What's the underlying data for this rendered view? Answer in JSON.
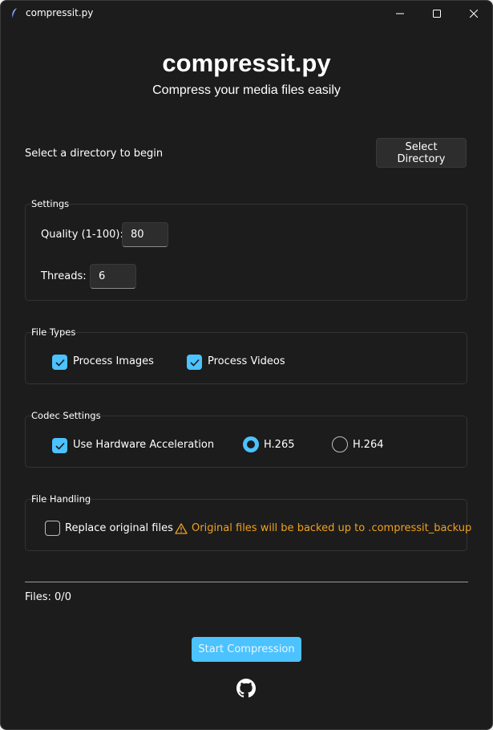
{
  "window": {
    "title": "compressit.py"
  },
  "header": {
    "title": "compressit.py",
    "subtitle": "Compress your media files easily"
  },
  "directory": {
    "prompt": "Select a directory to begin",
    "button_label": "Select Directory"
  },
  "settings": {
    "group_label": "Settings",
    "quality_label": "Quality (1-100):",
    "quality_value": "80",
    "threads_label": "Threads:",
    "threads_value": "6"
  },
  "file_types": {
    "group_label": "File Types",
    "images": {
      "label": "Process Images",
      "checked": true
    },
    "videos": {
      "label": "Process Videos",
      "checked": true
    }
  },
  "codec": {
    "group_label": "Codec Settings",
    "hw_accel": {
      "label": "Use Hardware Acceleration",
      "checked": true
    },
    "options": [
      "H.265",
      "H.264"
    ],
    "selected": "H.265"
  },
  "file_handling": {
    "group_label": "File Handling",
    "replace": {
      "label": "Replace original files",
      "checked": false
    },
    "warning": "Original files will be backed up to .compressit_backup"
  },
  "status": {
    "files": "Files: 0/0"
  },
  "actions": {
    "start_label": "Start Compression"
  },
  "icons": {
    "app": "feather-icon",
    "minimize": "minimize-icon",
    "maximize": "maximize-icon",
    "close": "close-icon",
    "checkmark": "checkmark-icon",
    "warning": "warning-icon",
    "github": "github-icon"
  },
  "colors": {
    "accent": "#4cc2ff",
    "warning": "#f0a020",
    "background": "#1c1c1c"
  }
}
